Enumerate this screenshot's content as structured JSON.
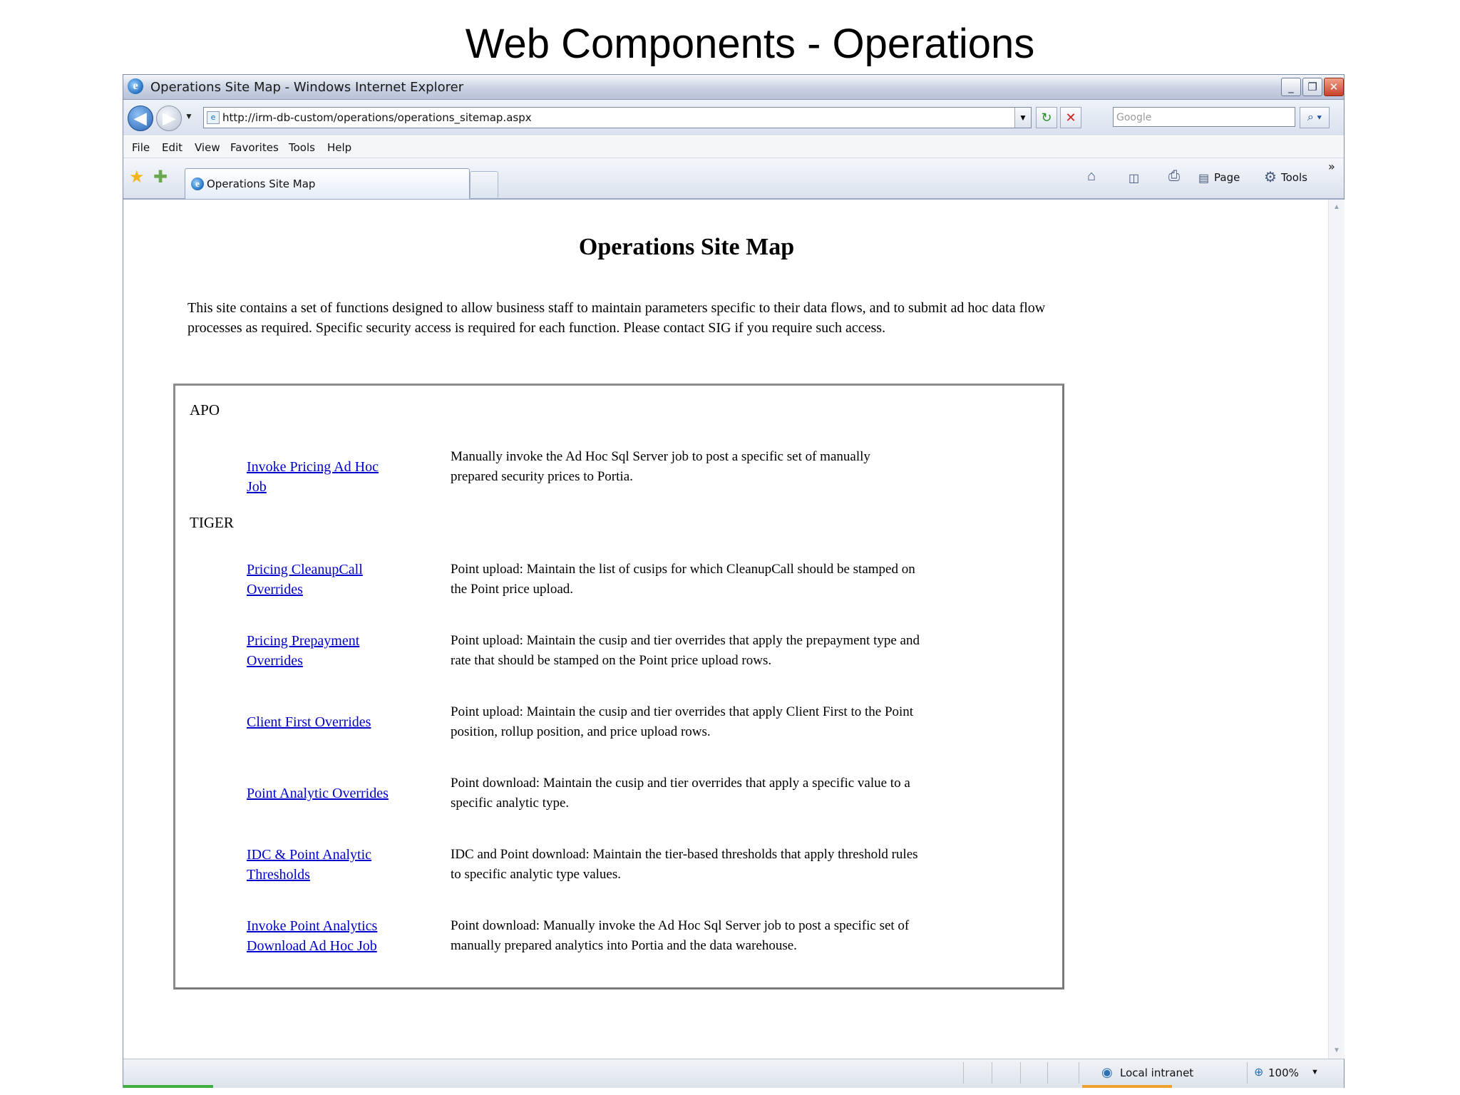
{
  "slide": {
    "title": "Web Components - Operations"
  },
  "window": {
    "title": "Operations Site Map - Windows Internet Explorer",
    "minimize_icon": "minimize-icon",
    "restore_icon": "restore-icon",
    "close_icon": "close-icon"
  },
  "navbar": {
    "url": "http://irm-db-custom/operations/operations_sitemap.aspx",
    "search_placeholder": "Google"
  },
  "menu": [
    "File",
    "Edit",
    "View",
    "Favorites",
    "Tools",
    "Help"
  ],
  "tabs": [
    {
      "label": "Operations Site Map"
    }
  ],
  "command_bar": {
    "page_label": "Page",
    "tools_label": "Tools"
  },
  "page": {
    "heading": "Operations Site Map",
    "intro": "This site contains a set of functions designed to allow business staff to maintain parameters specific to their data flows, and to submit ad hoc data flow processes as required. Specific security access is required for each function. Please contact SIG if you require such access.",
    "sections": [
      {
        "name": "APO",
        "items": [
          {
            "link": "Invoke Pricing Ad Hoc Job",
            "description": "Manually invoke the Ad Hoc Sql Server job to post a specific set of manually prepared security prices to Portia."
          }
        ]
      },
      {
        "name": "TIGER",
        "items": [
          {
            "link": "Pricing CleanupCall Overrides",
            "description": "Point upload: Maintain the list of cusips for which CleanupCall should be stamped on the Point price upload."
          },
          {
            "link": "Pricing Prepayment Overrides",
            "description": "Point upload: Maintain the cusip and tier overrides that apply the prepayment type and rate that should be stamped on the Point price upload rows."
          },
          {
            "link": "Client First Overrides",
            "description": "Point upload: Maintain the cusip and tier overrides that apply Client First to the Point position, rollup position, and price upload rows."
          },
          {
            "link": "Point Analytic Overrides",
            "description": "Point download: Maintain the cusip and tier overrides that apply a specific value to a specific analytic type."
          },
          {
            "link": "IDC & Point Analytic Thresholds",
            "description": "IDC and Point download: Maintain the tier-based thresholds that apply threshold rules to specific analytic type values."
          },
          {
            "link": "Invoke Point Analytics Download Ad Hoc Job",
            "description": "Point download: Manually invoke the Ad Hoc Sql Server job to post a specific set of manually prepared analytics into Portia and the data warehouse."
          }
        ]
      }
    ]
  },
  "statusbar": {
    "zone": "Local intranet",
    "zoom": "100%"
  },
  "colors": {
    "link": "#0000cc",
    "accent": "#1f6fc2"
  }
}
